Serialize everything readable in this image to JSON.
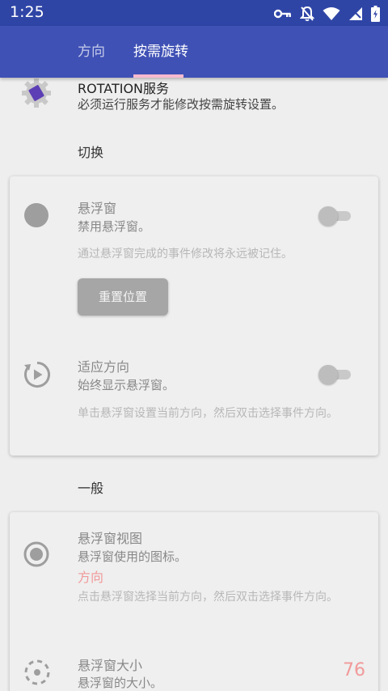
{
  "status_bar": {
    "time": "1:25",
    "icons": [
      "key-icon",
      "notifications-off-icon",
      "wifi-icon",
      "signal-icon",
      "battery-icon"
    ]
  },
  "tabs": [
    {
      "label": "方向",
      "active": false
    },
    {
      "label": "按需旋转",
      "active": true
    }
  ],
  "colors": {
    "status_bar": "#2f45a6",
    "app_bar": "#3f51b5",
    "tab_indicator": "#f8bbd0",
    "accent_value": "#f19a9a",
    "service_icon": "#5c3fb5"
  },
  "service": {
    "title": "ROTATION服务",
    "subtitle": "必须运行服务才能修改按需旋转设置。"
  },
  "sections": {
    "toggle_title": "切换",
    "general_title": "一般"
  },
  "floating_window": {
    "title": "悬浮窗",
    "subtitle": "禁用悬浮窗。",
    "description": "通过悬浮窗完成的事件修改将永远被记住。",
    "reset_button": "重置位置",
    "enabled": false
  },
  "adaptive_orientation": {
    "title": "适应方向",
    "subtitle": "始终显示悬浮窗。",
    "description": "单击悬浮窗设置当前方向，然后双击选择事件方向。",
    "enabled": false
  },
  "floating_view": {
    "title": "悬浮窗视图",
    "subtitle": "悬浮窗使用的图标。",
    "value": "方向",
    "description": "点击悬浮窗选择当前方向，然后双击选择事件方向。"
  },
  "floating_size": {
    "title": "悬浮窗大小",
    "subtitle": "悬浮窗的大小。",
    "value": "76"
  }
}
